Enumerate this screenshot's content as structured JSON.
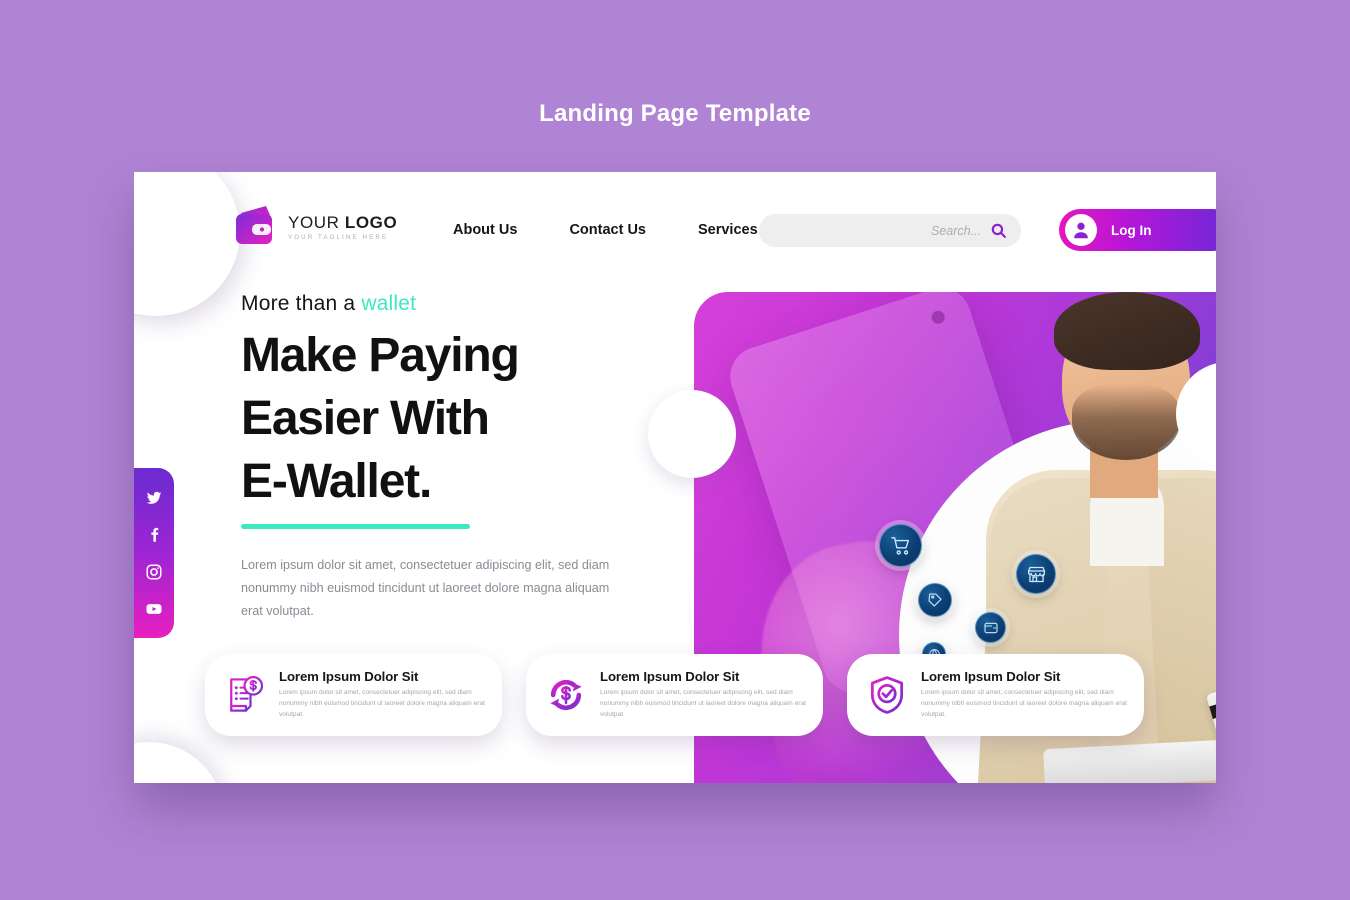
{
  "page": {
    "title": "Landing Page Template",
    "background_color": "#b084d4"
  },
  "header": {
    "logo": {
      "name_light": "YOUR ",
      "name_bold": "LOGO",
      "tagline": "YOUR TAGLINE HERE",
      "icon": "wallet-icon"
    },
    "nav": [
      {
        "label": "About Us"
      },
      {
        "label": "Contact Us"
      },
      {
        "label": "Services"
      }
    ],
    "search": {
      "placeholder": "Search...",
      "value": "",
      "icon": "search-icon"
    },
    "login": {
      "label": "Log In",
      "icon": "user-avatar-icon",
      "gradient_from": "#e515c0",
      "gradient_to": "#6a29d6"
    }
  },
  "hero": {
    "eyebrow_prefix": "More than a ",
    "eyebrow_accent": "wallet",
    "accent_color": "#3ee8c0",
    "headline_line1": "Make Paying",
    "headline_line2": "Easier With",
    "headline_line3": "E-Wallet.",
    "paragraph": "Lorem ipsum dolor sit amet, consectetuer adipiscing elit, sed diam nonummy nibh euismod tincidunt ut laoreet dolore magna aliquam erat volutpat.",
    "bubbles": [
      {
        "icon": "shopping-cart-icon"
      },
      {
        "icon": "store-icon"
      },
      {
        "icon": "price-tag-icon"
      },
      {
        "icon": "wallet-card-icon"
      },
      {
        "icon": "globe-icon"
      }
    ]
  },
  "social": {
    "items": [
      {
        "icon": "twitter-icon",
        "label": "Twitter"
      },
      {
        "icon": "facebook-icon",
        "label": "Facebook"
      },
      {
        "icon": "instagram-icon",
        "label": "Instagram"
      },
      {
        "icon": "youtube-icon",
        "label": "YouTube"
      }
    ],
    "gradient_from": "#6a2bd0",
    "gradient_to": "#e81fc0"
  },
  "cards": [
    {
      "icon": "invoice-dollar-icon",
      "title": "Lorem Ipsum Dolor Sit",
      "body": "Lorem ipsum dolor sit amet, consectetuer adipiscing elit, sed diam nonummy nibh euismod tincidunt ut laoreet dolore magna aliquam erat volutpat."
    },
    {
      "icon": "refresh-dollar-icon",
      "title": "Lorem Ipsum Dolor Sit",
      "body": "Lorem ipsum dolor sit amet, consectetuer adipiscing elit, sed diam nonummy nibh euismod tincidunt ut laoreet dolore magna aliquam erat volutpat."
    },
    {
      "icon": "shield-check-icon",
      "title": "Lorem Ipsum Dolor Sit",
      "body": "Lorem ipsum dolor sit amet, consectetuer adipiscing elit, sed diam nonummy nibh euismod tincidunt ut laoreet dolore magna aliquam erat volutpat."
    }
  ]
}
